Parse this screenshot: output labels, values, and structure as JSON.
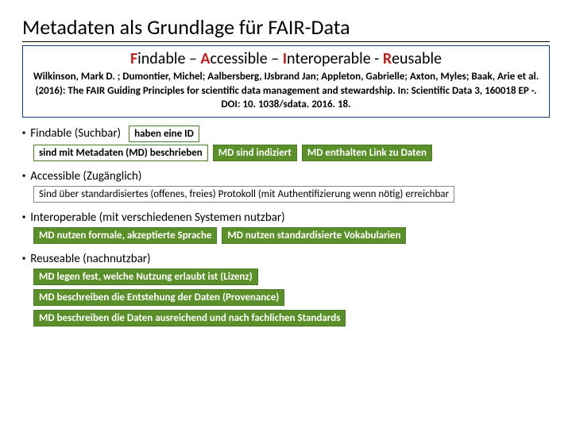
{
  "title": "Metadaten als Grundlage für FAIR-Data",
  "fair": {
    "f": "F",
    "findable": "indable",
    "a": "A",
    "accessible": "ccessible",
    "i": "I",
    "interoperable": "nteroperable",
    "r": "R",
    "reusable": "eusable",
    "sep": " – ",
    "sep2": " - "
  },
  "citation": "Wilkinson, Mark D. ; Dumontier, Michel; Aalbersberg, IJsbrand Jan; Appleton, Gabrielle; Axton, Myles; Baak, Arie et al. (2016): The FAIR Guiding Principles for scientific data management and stewardship. In: Scientific Data 3, 160018 EP -. DOI: 10. 1038/sdata. 2016. 18.",
  "sections": {
    "findable": {
      "head": "Findable (Suchbar)",
      "chip_id": "haben eine ID",
      "chip_md": "sind mit Metadaten (MD) beschrieben",
      "chip_indexed": "MD sind indiziert",
      "chip_link": "MD enthalten Link zu Daten"
    },
    "accessible": {
      "head": "Accessible (Zugänglich)",
      "chip": "Sind über standardisiertes (offenes, freies) Protokoll (mit Authentifizierung wenn nötig) erreichbar"
    },
    "interoperable": {
      "head": "Interoperable (mit verschiedenen Systemen nutzbar)",
      "chip_lang": "MD nutzen formale, akzeptierte Sprache",
      "chip_vocab": "MD nutzen standardisierte Vokabularien"
    },
    "reusable": {
      "head": "Reuseable (nachnutzbar)",
      "chip_license": "MD legen fest, welche Nutzung erlaubt ist (Lizenz)",
      "chip_prov": "MD beschreiben die Entstehung der Daten (Provenance)",
      "chip_std": "MD beschreiben die Daten ausreichend und nach fachlichen Standards"
    }
  }
}
